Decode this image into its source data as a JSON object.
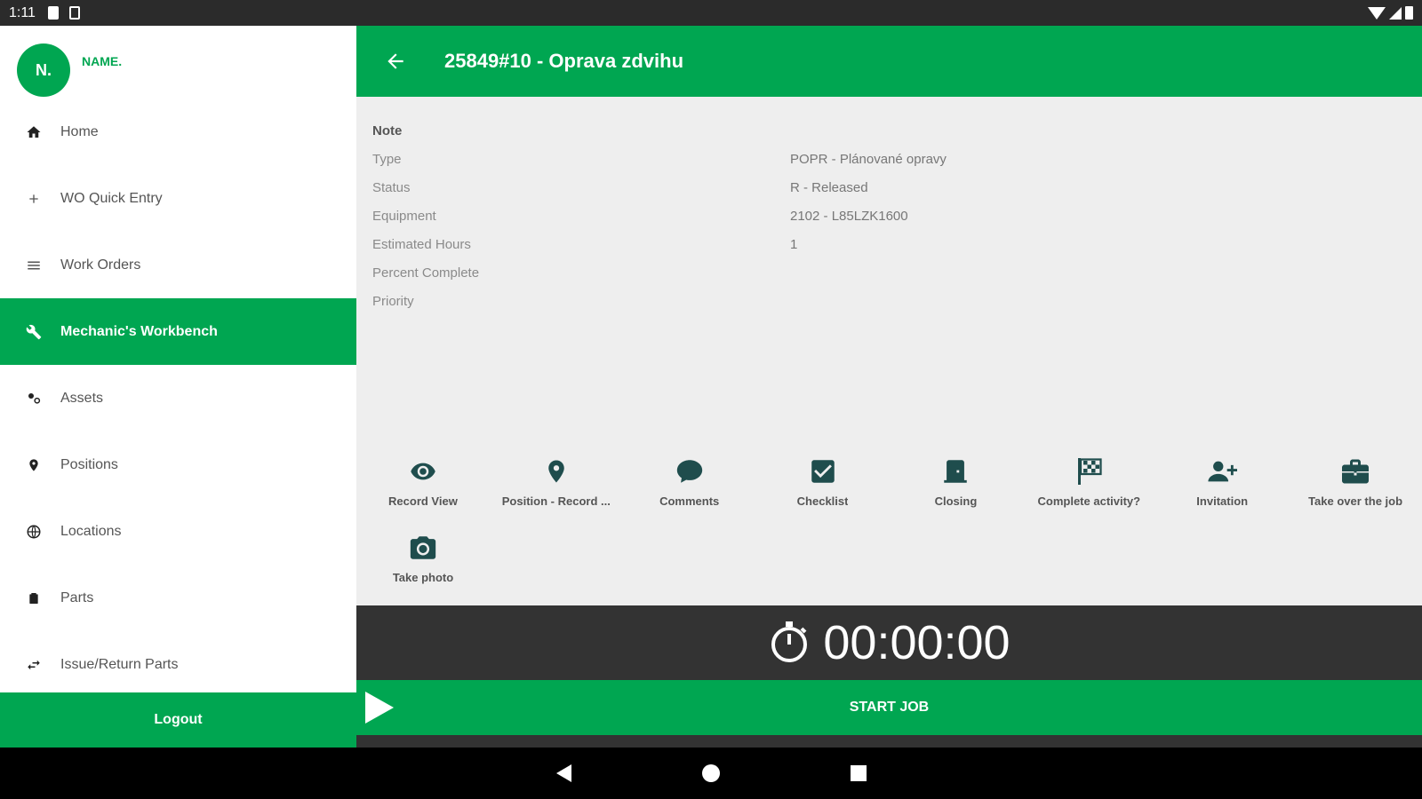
{
  "status_bar": {
    "time": "1:11"
  },
  "drawer": {
    "avatar_initial": "N.",
    "user_name": "NAME.",
    "items": [
      {
        "label": "Home",
        "icon": "home-icon"
      },
      {
        "label": "WO Quick Entry",
        "icon": "plus-icon"
      },
      {
        "label": "Work Orders",
        "icon": "list-icon"
      },
      {
        "label": "Mechanic's Workbench",
        "icon": "wrench-icon",
        "active": true
      },
      {
        "label": "Assets",
        "icon": "assets-icon"
      },
      {
        "label": "Positions",
        "icon": "pin-icon"
      },
      {
        "label": "Locations",
        "icon": "globe-icon"
      },
      {
        "label": "Parts",
        "icon": "parts-icon"
      },
      {
        "label": "Issue/Return Parts",
        "icon": "swap-icon"
      }
    ],
    "logout_label": "Logout"
  },
  "header": {
    "title": "25849#10 - Oprava zdvihu"
  },
  "details": {
    "note_label": "Note",
    "rows": [
      {
        "label": "Type",
        "value": "POPR - Plánované opravy"
      },
      {
        "label": "Status",
        "value": "R - Released"
      },
      {
        "label": "Equipment",
        "value": "2102 - L85LZK1600"
      },
      {
        "label": "Estimated Hours",
        "value": "1"
      },
      {
        "label": "Percent Complete",
        "value": ""
      },
      {
        "label": "Priority",
        "value": ""
      }
    ]
  },
  "actions": [
    {
      "label": "Record View",
      "icon": "eye-icon"
    },
    {
      "label": "Position - Record ...",
      "icon": "map-pin-icon"
    },
    {
      "label": "Comments",
      "icon": "comment-icon"
    },
    {
      "label": "Checklist",
      "icon": "checkbox-icon"
    },
    {
      "label": "Closing",
      "icon": "door-icon"
    },
    {
      "label": "Complete activity?",
      "icon": "flag-icon"
    },
    {
      "label": "Invitation",
      "icon": "add-person-icon"
    },
    {
      "label": "Take over the job",
      "icon": "briefcase-icon"
    },
    {
      "label": "Take photo",
      "icon": "camera-icon"
    }
  ],
  "timer": {
    "value": "00:00:00"
  },
  "start_job": {
    "label": "START JOB"
  },
  "colors": {
    "primary": "#00a651",
    "dark": "#333333",
    "panel": "#eeeeee"
  }
}
